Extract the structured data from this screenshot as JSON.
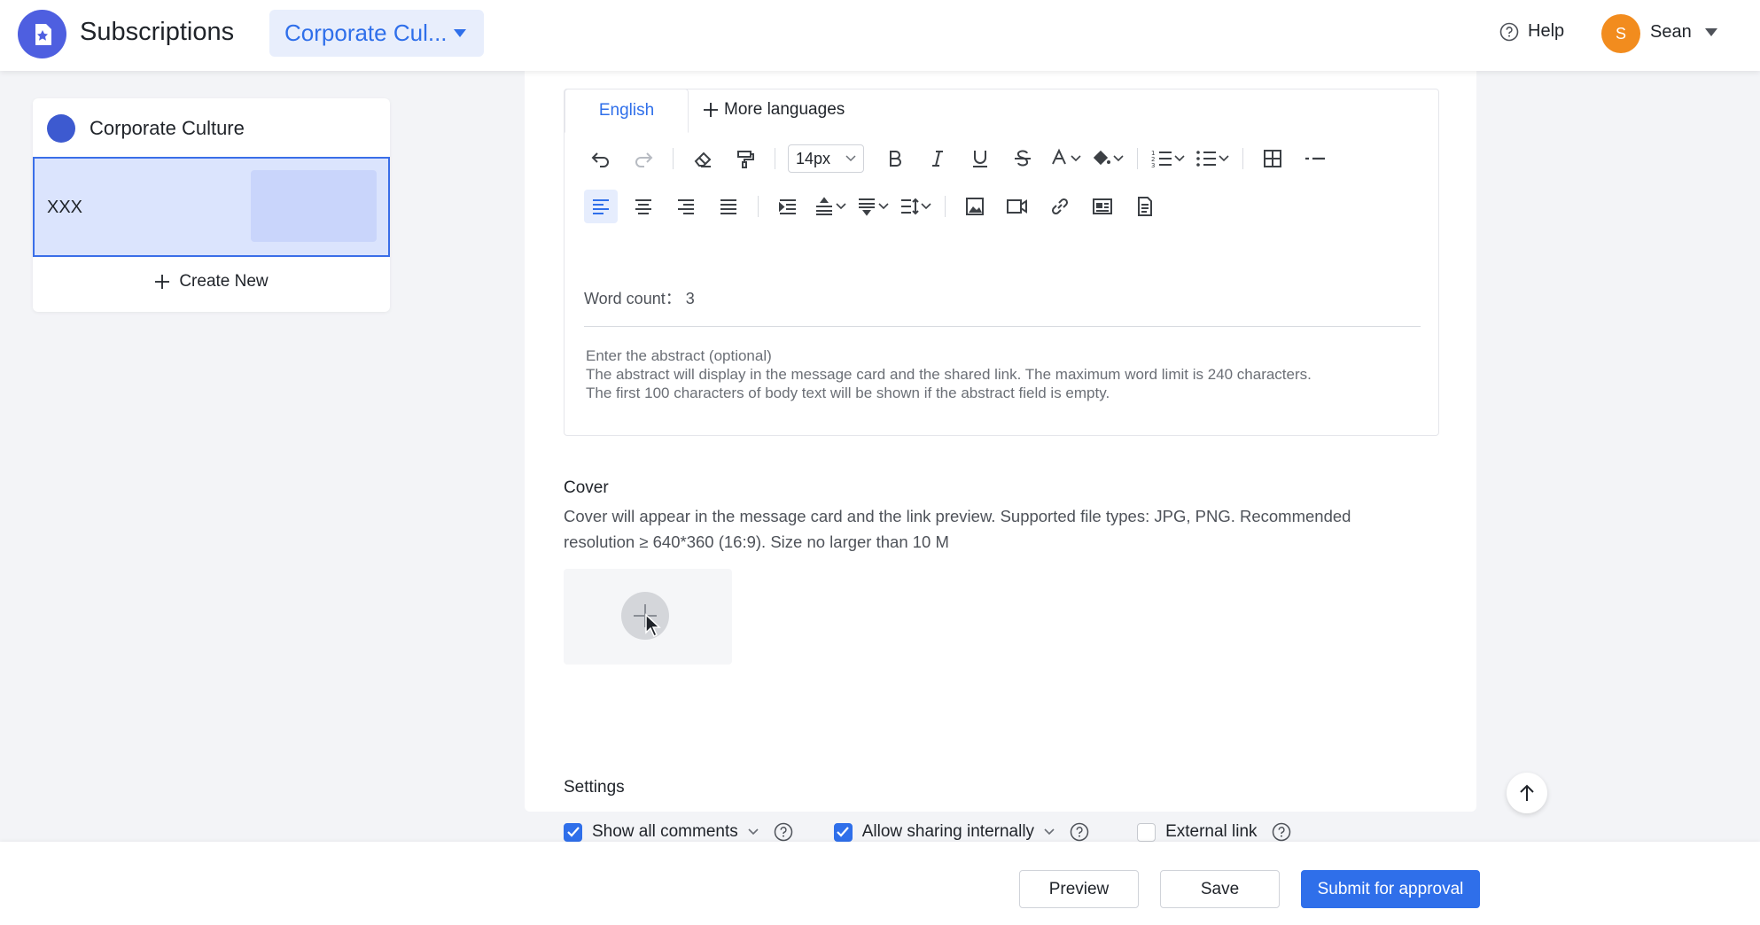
{
  "header": {
    "app_title": "Subscriptions",
    "channel_select": "Corporate Cul...",
    "help_label": "Help",
    "user_initial": "S",
    "user_name": "Sean"
  },
  "sidebar": {
    "channel_name": "Corporate Culture",
    "items": [
      {
        "title": "XXX"
      }
    ],
    "create_new_label": "Create New"
  },
  "editor": {
    "tabs": {
      "english": "English",
      "more_languages": "More languages"
    },
    "toolbar": {
      "font_size": "14px"
    },
    "word_count_label": "Word count：",
    "word_count_value": "3",
    "abstract_placeholder_1": "Enter the abstract (optional)",
    "abstract_placeholder_2": "The abstract will display in the message card and the shared link. The maximum word limit is 240 characters.",
    "abstract_placeholder_3": "The first 100 characters of body text will be shown if the abstract field is empty."
  },
  "cover": {
    "title": "Cover",
    "description_1": "Cover will appear in the message card and the link preview. Supported file types: JPG, PNG. Recommended",
    "description_2": "resolution ≥ 640*360 (16:9). Size no larger than 10 M"
  },
  "settings": {
    "title": "Settings",
    "options": [
      {
        "label": "Show all comments",
        "checked": true
      },
      {
        "label": "Allow sharing internally",
        "checked": true
      },
      {
        "label": "External link",
        "checked": false
      }
    ]
  },
  "footer": {
    "preview_label": "Preview",
    "save_label": "Save",
    "submit_label": "Submit for approval"
  },
  "colors": {
    "accent": "#2f6fea",
    "avatar": "#f28c1e",
    "logo": "#4e5fe0",
    "selected_item_bg": "#dbe4fd"
  }
}
